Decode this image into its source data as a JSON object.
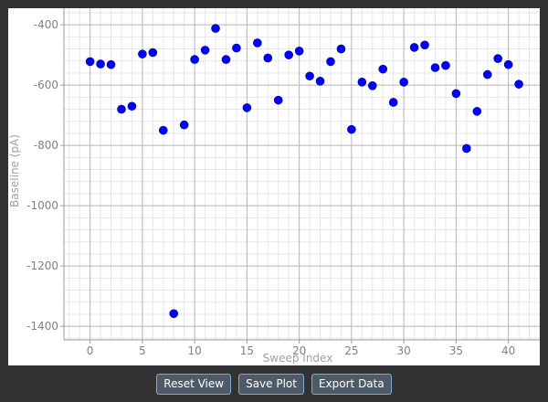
{
  "toolbar": {
    "reset_label": "Reset View",
    "save_label": "Save Plot",
    "export_label": "Export Data"
  },
  "colors": {
    "point": "#0000ff",
    "grid_major": "#b4b4b4",
    "grid_minor": "#e6e6e6",
    "axis": "#9a9a9a",
    "button_bg": "#4e5a68",
    "button_border": "#7fa8d6",
    "window_bg": "#323232"
  },
  "chart_data": {
    "type": "scatter",
    "title": "",
    "xlabel": "Sweep Index",
    "ylabel": "Baseline (pA)",
    "xlim": [
      -2.5,
      43
    ],
    "ylim": [
      -1445,
      -345
    ],
    "xticks": [
      0,
      5,
      10,
      15,
      20,
      25,
      30,
      35,
      40
    ],
    "yticks": [
      -400,
      -600,
      -800,
      -1000,
      -1200,
      -1400
    ],
    "grid": true,
    "minor_grid": true,
    "series": [
      {
        "x": [
          0,
          1,
          2,
          3,
          4,
          5,
          6,
          7,
          8,
          9,
          10,
          11,
          12,
          13,
          14,
          15,
          16,
          17,
          18,
          19,
          20,
          21,
          22,
          23,
          24,
          25,
          26,
          27,
          28,
          29,
          30,
          31,
          32,
          33,
          34,
          35,
          36,
          37,
          38,
          39,
          40,
          41
        ],
        "y": [
          -522,
          -530,
          -532,
          -680,
          -670,
          -497,
          -492,
          -750,
          -1358,
          -732,
          -515,
          -484,
          -412,
          -515,
          -477,
          -675,
          -460,
          -510,
          -650,
          -500,
          -487,
          -570,
          -587,
          -522,
          -480,
          -747,
          -590,
          -602,
          -547,
          -657,
          -590,
          -475,
          -467,
          -542,
          -535,
          -628,
          -810,
          -687,
          -565,
          -512,
          -532,
          -597
        ]
      }
    ]
  }
}
